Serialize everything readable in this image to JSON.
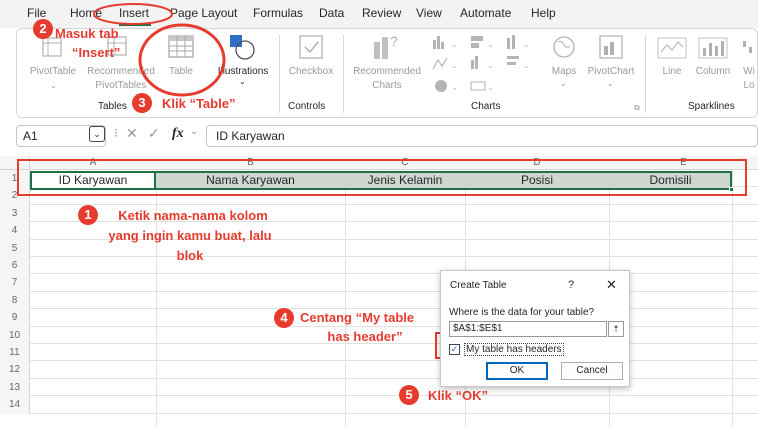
{
  "menu": {
    "file": "File",
    "home": "Home",
    "insert": "Insert",
    "page_layout": "Page Layout",
    "formulas": "Formulas",
    "data": "Data",
    "review": "Review",
    "view": "View",
    "automate": "Automate",
    "help": "Help"
  },
  "ribbon": {
    "pivottable": "PivotTable",
    "recommended_pivottables_1": "Recommended",
    "recommended_pivottables_2": "PivotTables",
    "table": "Table",
    "illustrations": "Illustrations",
    "checkbox": "Checkbox",
    "recommended_charts_1": "Recommended",
    "recommended_charts_2": "Charts",
    "maps": "Maps",
    "pivotchart": "PivotChart",
    "line": "Line",
    "column": "Column",
    "winloss_1": "Wi",
    "winloss_2": "Lo",
    "groups": {
      "tables": "Tables",
      "controls": "Controls",
      "charts": "Charts",
      "sparklines": "Sparklines"
    }
  },
  "formula_bar": {
    "name_box": "A1",
    "fx": "fx",
    "content": "ID Karyawan"
  },
  "grid": {
    "columns": [
      "A",
      "B",
      "C",
      "D",
      "E"
    ],
    "rows": [
      "1",
      "2",
      "3",
      "4",
      "5",
      "6",
      "7",
      "8",
      "9",
      "10",
      "11",
      "12",
      "13",
      "14"
    ],
    "row1": [
      "ID Karyawan",
      "Nama Karyawan",
      "Jenis Kelamin",
      "Posisi",
      "Domisili"
    ]
  },
  "annotations": {
    "step1_badge": "1",
    "step1_text_1": "Ketik nama-nama kolom",
    "step1_text_2": "yang ingin kamu buat, lalu",
    "step1_text_3": "blok",
    "step2_badge": "2",
    "step2_text_1": "Masuk tab",
    "step2_text_2": "“Insert”",
    "step3_badge": "3",
    "step3_text": "Klik “Table”",
    "step4_badge": "4",
    "step4_text_1": "Centang “My table",
    "step4_text_2": "has header”",
    "step5_badge": "5",
    "step5_text": "Klik “OK”"
  },
  "dialog": {
    "title": "Create Table",
    "help": "?",
    "close": "✕",
    "question": "Where is the data for your table?",
    "range": "$A$1:$E$1",
    "checkbox_label": "My table has headers",
    "ok": "OK",
    "cancel": "Cancel"
  },
  "colors": {
    "annotation": "#e63b2e",
    "excel_green": "#1e7145",
    "selection_fill": "#cfd6cf"
  }
}
